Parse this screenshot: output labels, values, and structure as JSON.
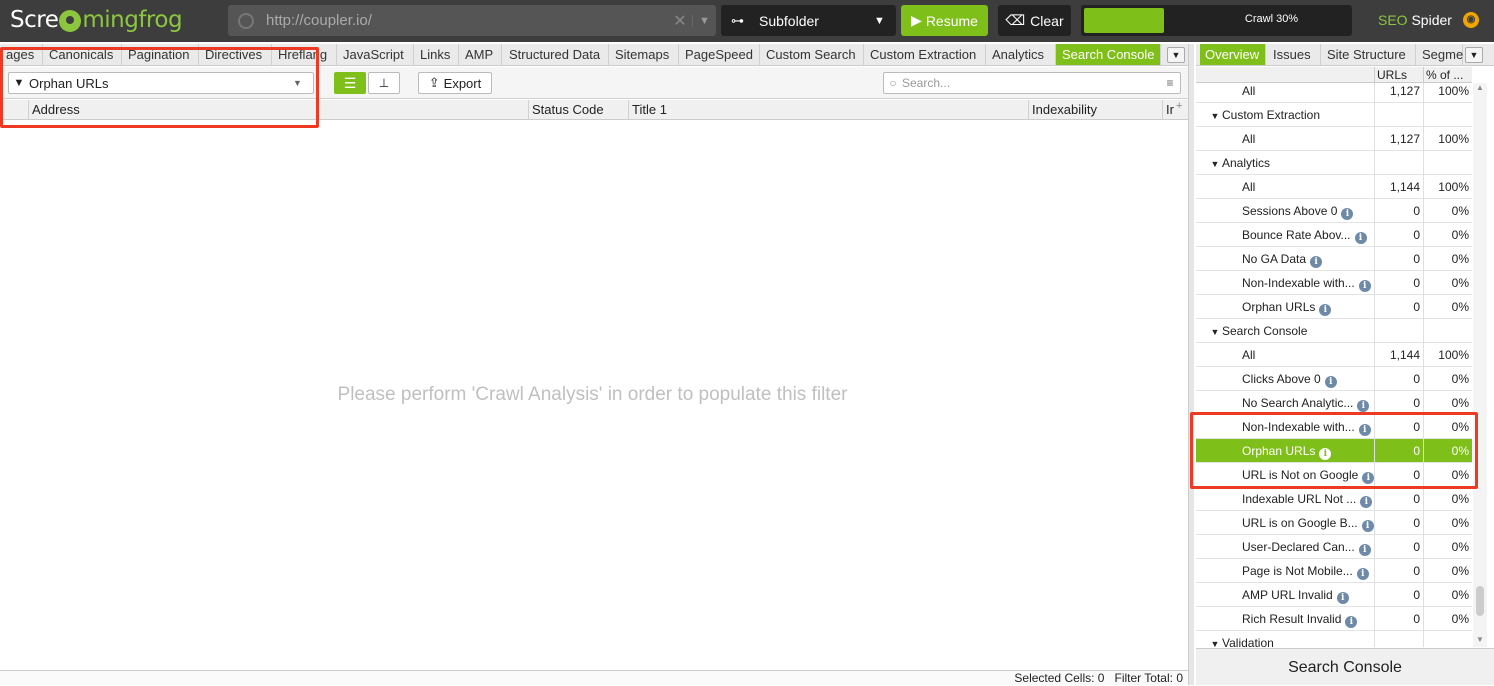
{
  "header": {
    "logo_text_a": "Scre",
    "logo_text_b": "mingfrog",
    "url": "http://coupler.io/",
    "mode": "Subfolder",
    "resume_label": "Resume",
    "clear_label": "Clear",
    "crawl_progress_label": "Crawl 30%",
    "crawl_progress": 0.3,
    "brand_seo": "SEO",
    "brand_spider": "Spider"
  },
  "tabs": [
    {
      "label": "ages"
    },
    {
      "label": "Canonicals"
    },
    {
      "label": "Pagination"
    },
    {
      "label": "Directives"
    },
    {
      "label": "Hreflang"
    },
    {
      "label": "JavaScript"
    },
    {
      "label": "Links"
    },
    {
      "label": "AMP"
    },
    {
      "label": "Structured Data"
    },
    {
      "label": "Sitemaps"
    },
    {
      "label": "PageSpeed"
    },
    {
      "label": "Custom Search"
    },
    {
      "label": "Custom Extraction"
    },
    {
      "label": "Analytics"
    },
    {
      "label": "Search Console",
      "active": true
    }
  ],
  "toolbar": {
    "filter_value": "Orphan URLs",
    "export_label": "Export",
    "search_placeholder": "Search..."
  },
  "columns": [
    "Address",
    "Status Code",
    "Title 1",
    "Indexability",
    "Ir"
  ],
  "empty_message": "Please perform 'Crawl Analysis' in order to populate this filter",
  "status": {
    "selected_cells_label": "Selected Cells:",
    "selected_cells": "0",
    "filter_total_label": "Filter Total:",
    "filter_total": "0"
  },
  "right_tabs": [
    {
      "label": "Overview",
      "active": true
    },
    {
      "label": "Issues"
    },
    {
      "label": "Site Structure"
    },
    {
      "label": "Segme"
    }
  ],
  "right_headers": {
    "urls": "URLs",
    "pct": "% of ..."
  },
  "tree": [
    {
      "name": "All",
      "level": 2,
      "urls": "1,127",
      "pct": "100%"
    },
    {
      "name": "Custom Extraction",
      "level": 1,
      "group": true,
      "urls": "",
      "pct": ""
    },
    {
      "name": "All",
      "level": 2,
      "urls": "1,127",
      "pct": "100%"
    },
    {
      "name": "Analytics",
      "level": 1,
      "group": true,
      "urls": "",
      "pct": ""
    },
    {
      "name": "All",
      "level": 2,
      "urls": "1,144",
      "pct": "100%"
    },
    {
      "name": "Sessions Above 0",
      "level": 2,
      "info": true,
      "urls": "0",
      "pct": "0%"
    },
    {
      "name": "Bounce Rate Abov...",
      "level": 2,
      "info": true,
      "urls": "0",
      "pct": "0%"
    },
    {
      "name": "No GA Data",
      "level": 2,
      "info": true,
      "urls": "0",
      "pct": "0%"
    },
    {
      "name": "Non-Indexable with...",
      "level": 2,
      "info": true,
      "urls": "0",
      "pct": "0%"
    },
    {
      "name": "Orphan URLs",
      "level": 2,
      "info": true,
      "urls": "0",
      "pct": "0%"
    },
    {
      "name": "Search Console",
      "level": 1,
      "group": true,
      "urls": "",
      "pct": ""
    },
    {
      "name": "All",
      "level": 2,
      "urls": "1,144",
      "pct": "100%"
    },
    {
      "name": "Clicks Above 0",
      "level": 2,
      "info": true,
      "urls": "0",
      "pct": "0%"
    },
    {
      "name": "No Search Analytic...",
      "level": 2,
      "info": true,
      "urls": "0",
      "pct": "0%"
    },
    {
      "name": "Non-Indexable with...",
      "level": 2,
      "info": true,
      "urls": "0",
      "pct": "0%"
    },
    {
      "name": "Orphan URLs",
      "level": 2,
      "info": true,
      "selected": true,
      "urls": "0",
      "pct": "0%"
    },
    {
      "name": "URL is Not on Google",
      "level": 2,
      "info": true,
      "urls": "0",
      "pct": "0%"
    },
    {
      "name": "Indexable URL Not ...",
      "level": 2,
      "info": true,
      "urls": "0",
      "pct": "0%"
    },
    {
      "name": "URL is on Google B...",
      "level": 2,
      "info": true,
      "urls": "0",
      "pct": "0%"
    },
    {
      "name": "User-Declared Can...",
      "level": 2,
      "info": true,
      "urls": "0",
      "pct": "0%"
    },
    {
      "name": "Page is Not Mobile...",
      "level": 2,
      "info": true,
      "urls": "0",
      "pct": "0%"
    },
    {
      "name": "AMP URL Invalid",
      "level": 2,
      "info": true,
      "urls": "0",
      "pct": "0%"
    },
    {
      "name": "Rich Result Invalid",
      "level": 2,
      "info": true,
      "urls": "0",
      "pct": "0%"
    },
    {
      "name": "Validation",
      "level": 1,
      "group": true,
      "urls": "",
      "pct": ""
    }
  ],
  "right_footer": "Search Console",
  "colors": {
    "accent": "#7fbf1a",
    "annotation": "#ef3a23",
    "topbar": "#3d3d3d"
  }
}
